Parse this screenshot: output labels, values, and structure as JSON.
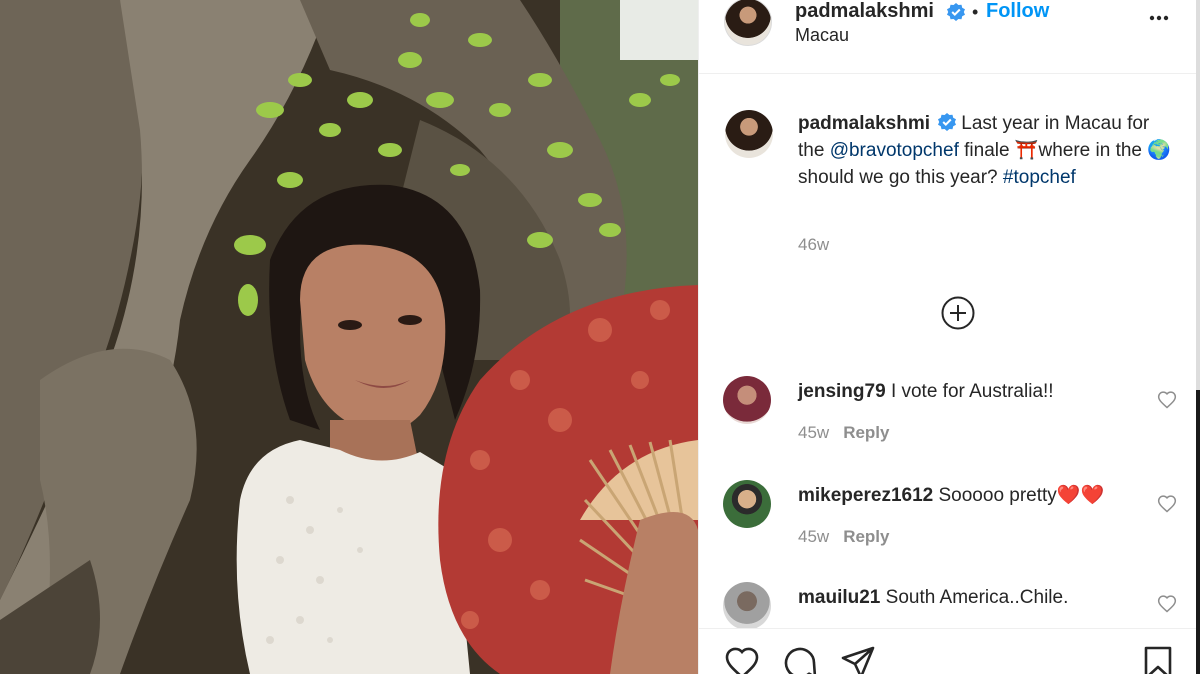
{
  "post": {
    "image_alt": "Woman in white lace top holding a red patterned fan in front of a tree with green leaves"
  },
  "header": {
    "username": "padmalakshmi",
    "dot": "•",
    "follow_label": "Follow",
    "location": "Macau",
    "more_icon": "more-horizontal-icon"
  },
  "caption": {
    "username": "padmalakshmi",
    "text_1": "Last year in Macau for the ",
    "mention": "@bravotopchef",
    "text_2": " finale ⛩️where in the 🌍should we go this year? ",
    "hashtag": "#topchef",
    "time": "46w"
  },
  "load_more_icon": "plus-circle-icon",
  "comments": [
    {
      "username": "jensing79",
      "text": "I vote for Australia!!",
      "time": "45w",
      "reply": "Reply",
      "avatar_color": "#7a2a3a"
    },
    {
      "username": "mikeperez1612",
      "text": "Sooooo pretty❤️❤️",
      "time": "45w",
      "reply": "Reply",
      "avatar_color": "#3b6d3a"
    },
    {
      "username": "mauilu21",
      "text": "South America..Chile.",
      "time": "",
      "reply": "",
      "avatar_color": "#8a8a8a"
    }
  ],
  "actions": {
    "like_icon": "heart-icon",
    "comment_icon": "comment-icon",
    "share_icon": "paper-plane-icon",
    "save_icon": "bookmark-icon"
  },
  "colors": {
    "link": "#00376b",
    "follow": "#0095f6",
    "muted": "#8e8e8e",
    "verified": "#3897f0"
  }
}
